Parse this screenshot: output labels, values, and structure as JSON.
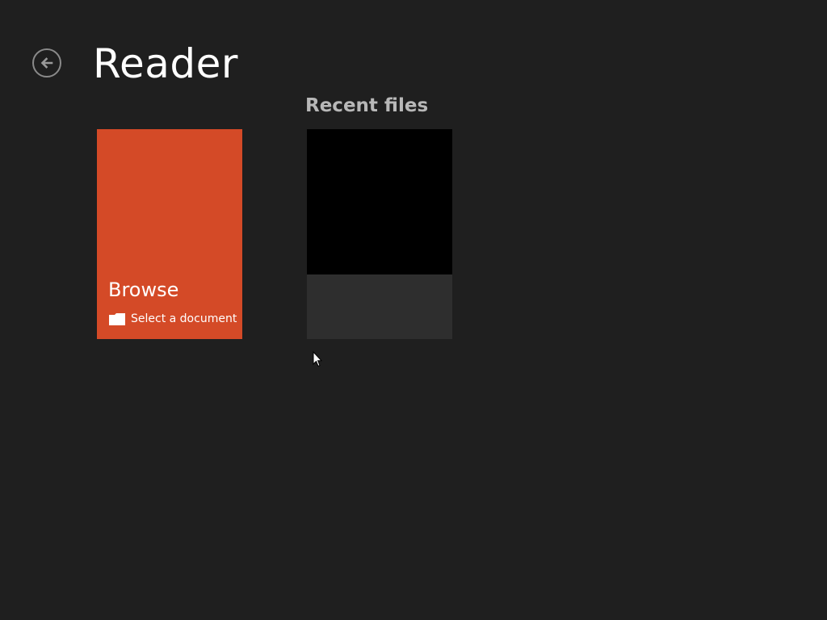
{
  "header": {
    "back_icon": "back-arrow-icon",
    "app_title": "Reader"
  },
  "browse": {
    "label": "Browse",
    "sublabel": "Select a document",
    "icon": "folder-icon",
    "color": "#d44a27"
  },
  "recent": {
    "section_title": "Recent files",
    "files": [
      {
        "thumbnail_color": "#000000",
        "caption_color": "#2e2e2e"
      }
    ]
  },
  "theme": {
    "background": "#1f1f1f"
  }
}
